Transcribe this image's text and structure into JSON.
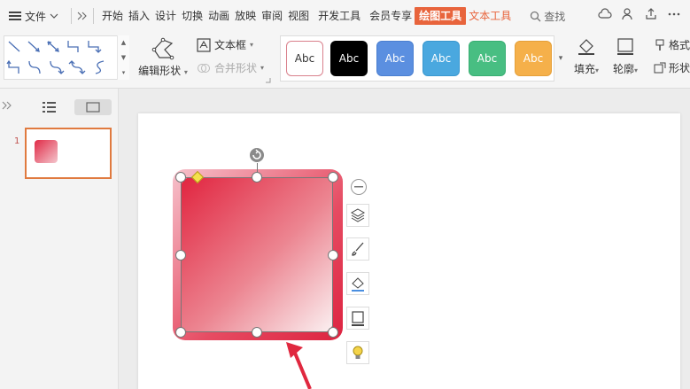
{
  "menubar": {
    "file_label": "文件",
    "tabs": [
      "开始",
      "插入",
      "设计",
      "切换",
      "动画",
      "放映",
      "审阅",
      "视图",
      "开发工具",
      "会员专享",
      "绘图工具",
      "文本工具"
    ],
    "active_tab": "绘图工具",
    "search_label": "查找"
  },
  "ribbon": {
    "edit_shape_label": "编辑形状",
    "textbox_label": "文本框",
    "merge_shape_label": "合并形状",
    "style_labels": [
      "Abc",
      "Abc",
      "Abc",
      "Abc",
      "Abc",
      "Abc"
    ],
    "style_colors": [
      "#ffffff",
      "#000000",
      "#5b8fe0",
      "#4aa8df",
      "#48be82",
      "#f5b04a"
    ],
    "fill_label": "填充",
    "outline_label": "轮廓",
    "format_label": "格式",
    "shape_effect_label": "形状"
  },
  "slides_panel": {
    "slide_number": "1"
  },
  "colors": {
    "accent": "#e8643c",
    "shape_dark": "#dd2340",
    "shape_light": "#fbf1f2",
    "arrow": "#e0283f"
  }
}
